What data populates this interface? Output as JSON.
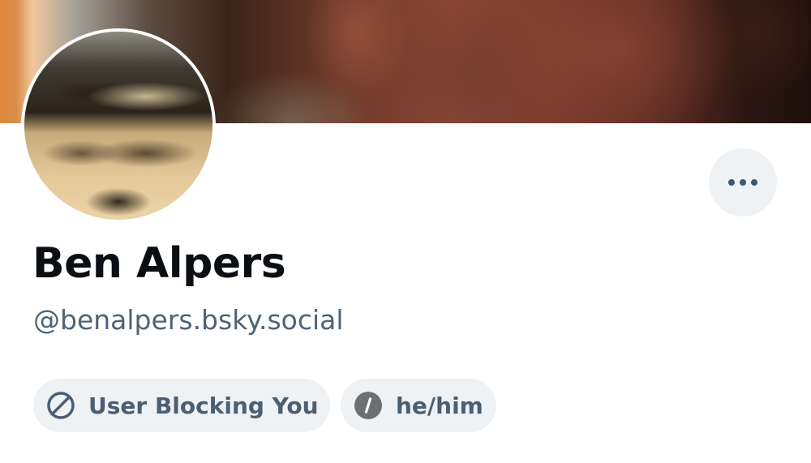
{
  "profile": {
    "display_name": "Ben Alpers",
    "handle": "@benalpers.bsky.social",
    "more_icon": "ellipsis-icon"
  },
  "badges": {
    "blocking": {
      "label": "User Blocking You",
      "icon": "block-icon"
    },
    "pronouns": {
      "label": "he/him",
      "icon": "pronoun-slash-icon"
    }
  },
  "colors": {
    "name_text": "#0b0f14",
    "secondary_text": "#4f6377",
    "pill_background": "#eef2f5"
  }
}
